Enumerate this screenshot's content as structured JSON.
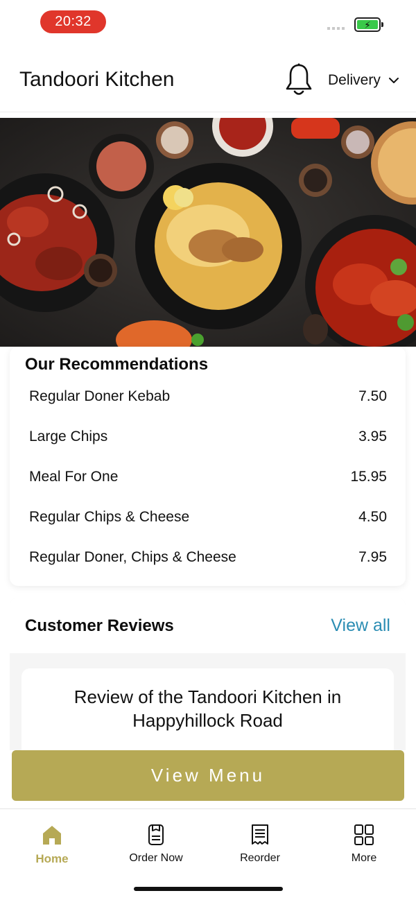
{
  "status_bar": {
    "time": "20:32",
    "battery_color": "#39c94a",
    "battery_icon": "charging-bolt"
  },
  "header": {
    "title": "Tandoori Kitchen",
    "bell_icon": "bell-icon",
    "delivery_label": "Delivery",
    "delivery_icon": "chevron-down-icon"
  },
  "hero": {
    "description_icon": "food-photo"
  },
  "recommendations": {
    "title": "Our Recommendations",
    "items": [
      {
        "name": "Regular Doner Kebab",
        "price": "7.50"
      },
      {
        "name": "Large Chips",
        "price": "3.95"
      },
      {
        "name": "Meal For One",
        "price": "15.95"
      },
      {
        "name": "Regular Chips & Cheese",
        "price": "4.50"
      },
      {
        "name": "Regular Doner, Chips & Cheese",
        "price": "7.95"
      }
    ]
  },
  "reviews": {
    "title": "Customer Reviews",
    "view_all": "View all",
    "first_review_heading": "Review of the Tandoori Kitchen in Happyhillock Road"
  },
  "cta": {
    "view_menu": "View Menu",
    "color": "#b6a955"
  },
  "bottom_nav": {
    "items": [
      {
        "label": "Home",
        "icon": "home-icon",
        "active": true
      },
      {
        "label": "Order Now",
        "icon": "order-icon",
        "active": false
      },
      {
        "label": "Reorder",
        "icon": "receipt-icon",
        "active": false
      },
      {
        "label": "More",
        "icon": "grid-icon",
        "active": false
      }
    ],
    "active_color": "#b6a955"
  }
}
